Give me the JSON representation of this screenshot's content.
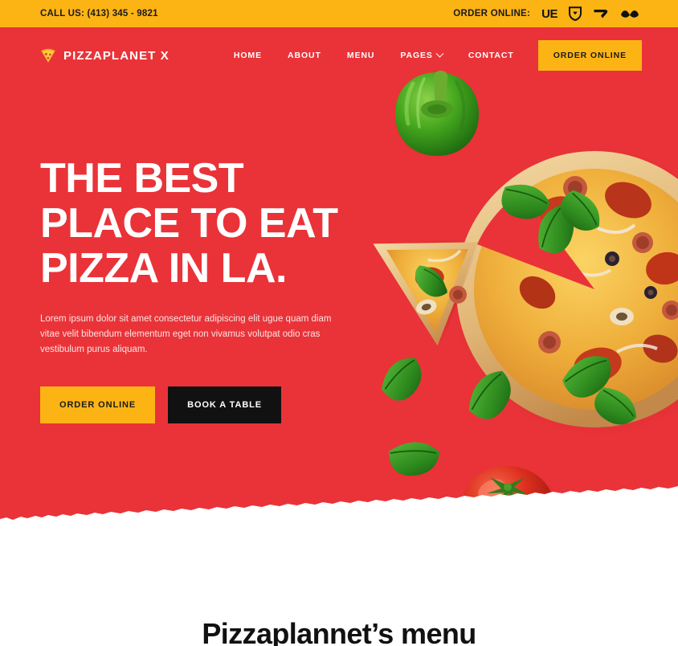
{
  "topbar": {
    "phone_label": "CALL US: (413) 345 - 9821",
    "order_online_label": "ORDER ONLINE:",
    "delivery_services": [
      {
        "name": "ubereats-icon",
        "label": "UE"
      },
      {
        "name": "doordash-icon",
        "label": ""
      },
      {
        "name": "grubhub-icon",
        "label": ""
      },
      {
        "name": "postmates-icon",
        "label": ""
      }
    ],
    "background_color": "#FCB415",
    "text_color": "#1a1a1a"
  },
  "header": {
    "brand_name": "PIZZAPLANET X",
    "brand_icon": "pizza-slice-icon",
    "nav": [
      {
        "label": "HOME",
        "has_dropdown": false
      },
      {
        "label": "ABOUT",
        "has_dropdown": false
      },
      {
        "label": "MENU",
        "has_dropdown": false
      },
      {
        "label": "PAGES",
        "has_dropdown": true
      },
      {
        "label": "CONTACT",
        "has_dropdown": false
      }
    ],
    "cta_label": "ORDER ONLINE"
  },
  "hero": {
    "title": "THE BEST\nPLACE TO EAT\nPIZZA IN LA.",
    "subtitle": "Lorem ipsum dolor sit amet consectetur adipiscing elit ugue quam diam vitae velit bibendum elementum eget non vivamus volutpat odio cras vestibulum purus aliquam.",
    "primary_button": "ORDER ONLINE",
    "secondary_button": "BOOK A TABLE",
    "background_color": "#E93338",
    "accent_color": "#FCB415",
    "food_items": [
      "green-bell-pepper",
      "pizza-slice",
      "whole-pizza",
      "basil-leaves",
      "tomato"
    ]
  },
  "menu_section": {
    "heading": "Pizzaplannet’s menu",
    "background_color": "#ffffff",
    "text_color": "#111111"
  }
}
